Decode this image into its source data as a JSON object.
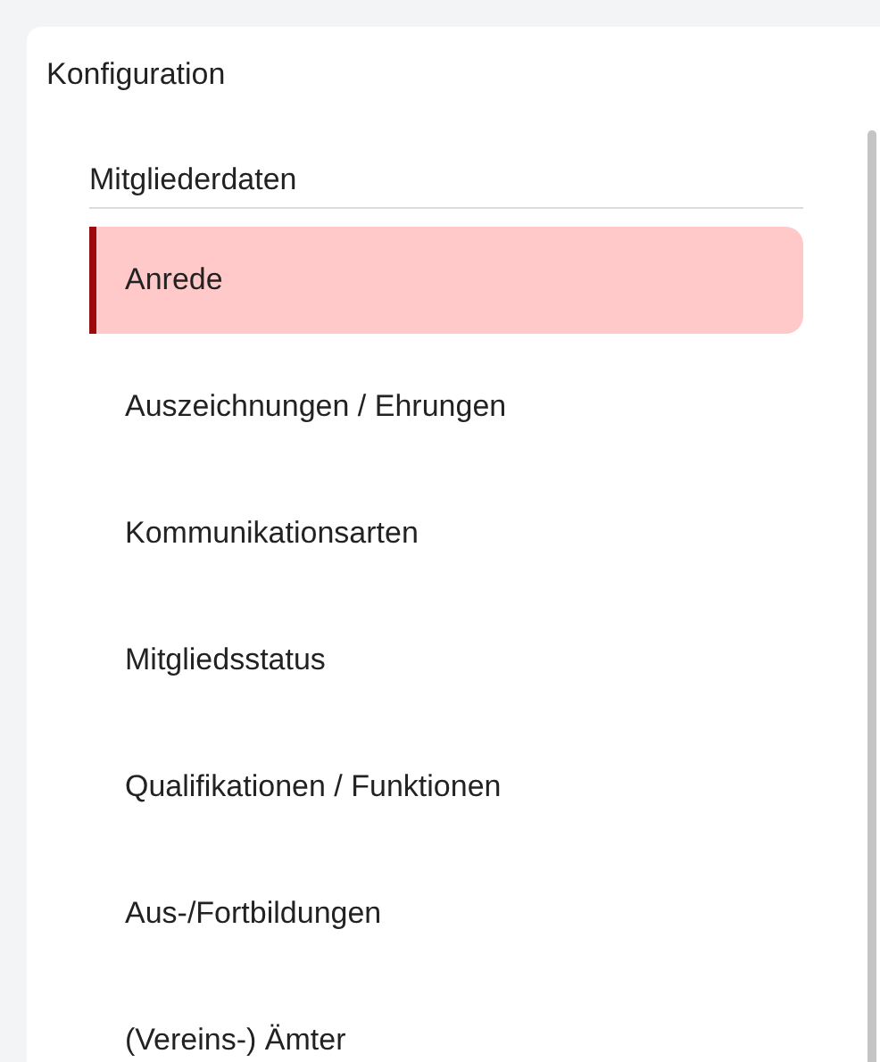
{
  "panel": {
    "title": "Konfiguration"
  },
  "section": {
    "heading": "Mitgliederdaten",
    "items": [
      {
        "label": "Anrede",
        "selected": true
      },
      {
        "label": "Auszeichnungen / Ehrungen",
        "selected": false
      },
      {
        "label": "Kommunikationsarten",
        "selected": false
      },
      {
        "label": "Mitgliedsstatus",
        "selected": false
      },
      {
        "label": "Qualifikationen / Funktionen",
        "selected": false
      },
      {
        "label": "Aus-/Fortbildungen",
        "selected": false
      },
      {
        "label": "(Vereins-) Ämter",
        "selected": false
      }
    ]
  }
}
